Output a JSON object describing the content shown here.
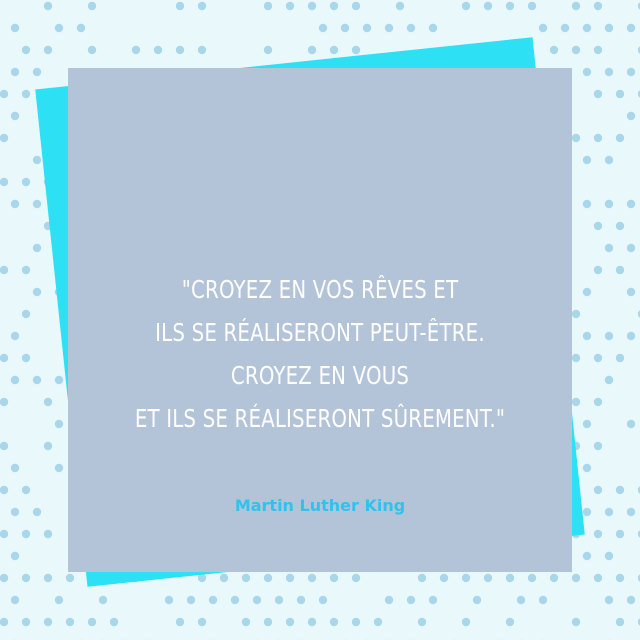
{
  "colors": {
    "background": "#e9f9fb",
    "dots": "#a9d6ea",
    "accent_square": "#2ee0f4",
    "card": "#b3c3d8",
    "quote_text": "#ffffff",
    "author_text": "#2ec3ee"
  },
  "quote": {
    "lines": [
      "\"CROYEZ EN VOS RÊVES ET",
      "ILS SE RÉALISERONT PEUT-ÊTRE.",
      "CROYEZ EN VOUS",
      "ET ILS SE RÉALISERONT SÛREMENT.\""
    ],
    "author": "Martin Luther King"
  },
  "decorations": {
    "dot_pattern": "polka-dots",
    "accent_shape": "rotated-square"
  }
}
